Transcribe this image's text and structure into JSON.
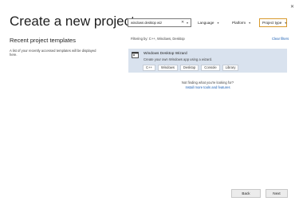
{
  "title": "Create a new project",
  "recent": {
    "heading": "Recent project templates",
    "description": "A list of your recently accessed templates will be displayed here."
  },
  "search": {
    "value": "windows desktop wiz",
    "clear_glyph": "✕",
    "dropdown_glyph": "▾"
  },
  "filters": {
    "language": "Language",
    "platform": "Platform",
    "project_type": "Project type",
    "chevron": "▾"
  },
  "filtering_text": "Filtering by: C++, Windows, Desktop",
  "clear_filters": "Clear filters",
  "template": {
    "name": "Windows Desktop Wizard",
    "description": "Create your own Windows app using a wizard.",
    "tags": [
      "C++",
      "Windows",
      "Desktop",
      "Console",
      "Library"
    ],
    "icon": "windows-app-icon"
  },
  "not_finding": "Not finding what you're looking for?",
  "install_link": "Install more tools and features",
  "buttons": {
    "back": "Back",
    "next": "Next"
  },
  "close_glyph": "✕",
  "colors": {
    "accent_link": "#1a5fb4",
    "selected_card": "#d9e2ee",
    "focused_filter_border": "#d89a2d"
  }
}
